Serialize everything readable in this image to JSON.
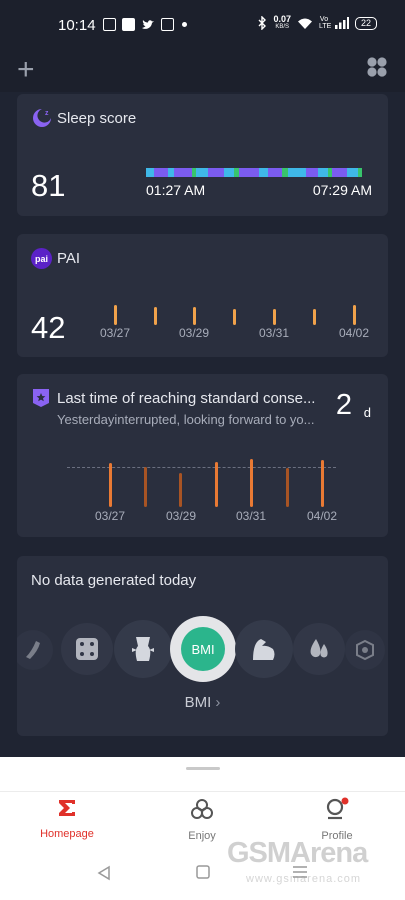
{
  "status_bar": {
    "time": "10:14",
    "net_speed_value": "0.07",
    "net_speed_unit": "KB/S",
    "volte": "Vo LTE",
    "battery": "22"
  },
  "top_bar": {
    "add_label": "+"
  },
  "sleep_card": {
    "title": "Sleep score",
    "score": "81",
    "start_time": "01:27 AM",
    "end_time": "07:29 AM"
  },
  "pai_card": {
    "icon_text": "pai",
    "title": "PAI",
    "value": "42",
    "dates": [
      "03/27",
      "03/29",
      "03/31",
      "04/02"
    ]
  },
  "standard_card": {
    "title": "Last time of reaching standard conse...",
    "subtitle": "Yesterdayinterrupted, looking forward to yo...",
    "value": "2",
    "unit": "d",
    "dates": [
      "03/27",
      "03/29",
      "03/31",
      "04/02"
    ]
  },
  "metrics_card": {
    "no_data": "No data generated today",
    "bmi_circle": "BMI",
    "bmi_link": "BMI"
  },
  "bottom_nav": {
    "items": [
      {
        "label": "Homepage"
      },
      {
        "label": "Enjoy"
      },
      {
        "label": "Profile"
      }
    ]
  },
  "watermark": {
    "brand": "GSMArena",
    "url": "www.gsmarena.com"
  },
  "colors": {
    "accent_red": "#e0312a",
    "pai_purple": "#5b22c7",
    "sleep_purple": "#7b5cf0",
    "tick_orange": "#f0a24b",
    "bmi_green": "#2bb58c"
  }
}
